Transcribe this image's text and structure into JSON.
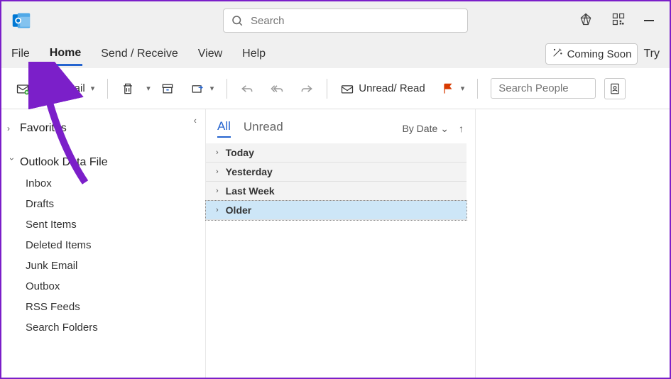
{
  "titlebar": {
    "search_placeholder": "Search"
  },
  "menu": {
    "tabs": [
      "File",
      "Home",
      "Send / Receive",
      "View",
      "Help"
    ],
    "active_index": 1,
    "coming_soon": "Coming Soon",
    "try": "Try"
  },
  "toolbar": {
    "new_email": "New Email",
    "unread_read": "Unread/ Read",
    "search_people_placeholder": "Search People"
  },
  "nav": {
    "favorites": "Favorites",
    "data_file": "Outlook Data File",
    "folders": [
      "Inbox",
      "Drafts",
      "Sent Items",
      "Deleted Items",
      "Junk Email",
      "Outbox",
      "RSS Feeds",
      "Search Folders"
    ]
  },
  "list": {
    "tabs": {
      "all": "All",
      "unread": "Unread"
    },
    "sort_label": "By Date",
    "groups": [
      "Today",
      "Yesterday",
      "Last Week",
      "Older"
    ],
    "selected_group_index": 3
  }
}
